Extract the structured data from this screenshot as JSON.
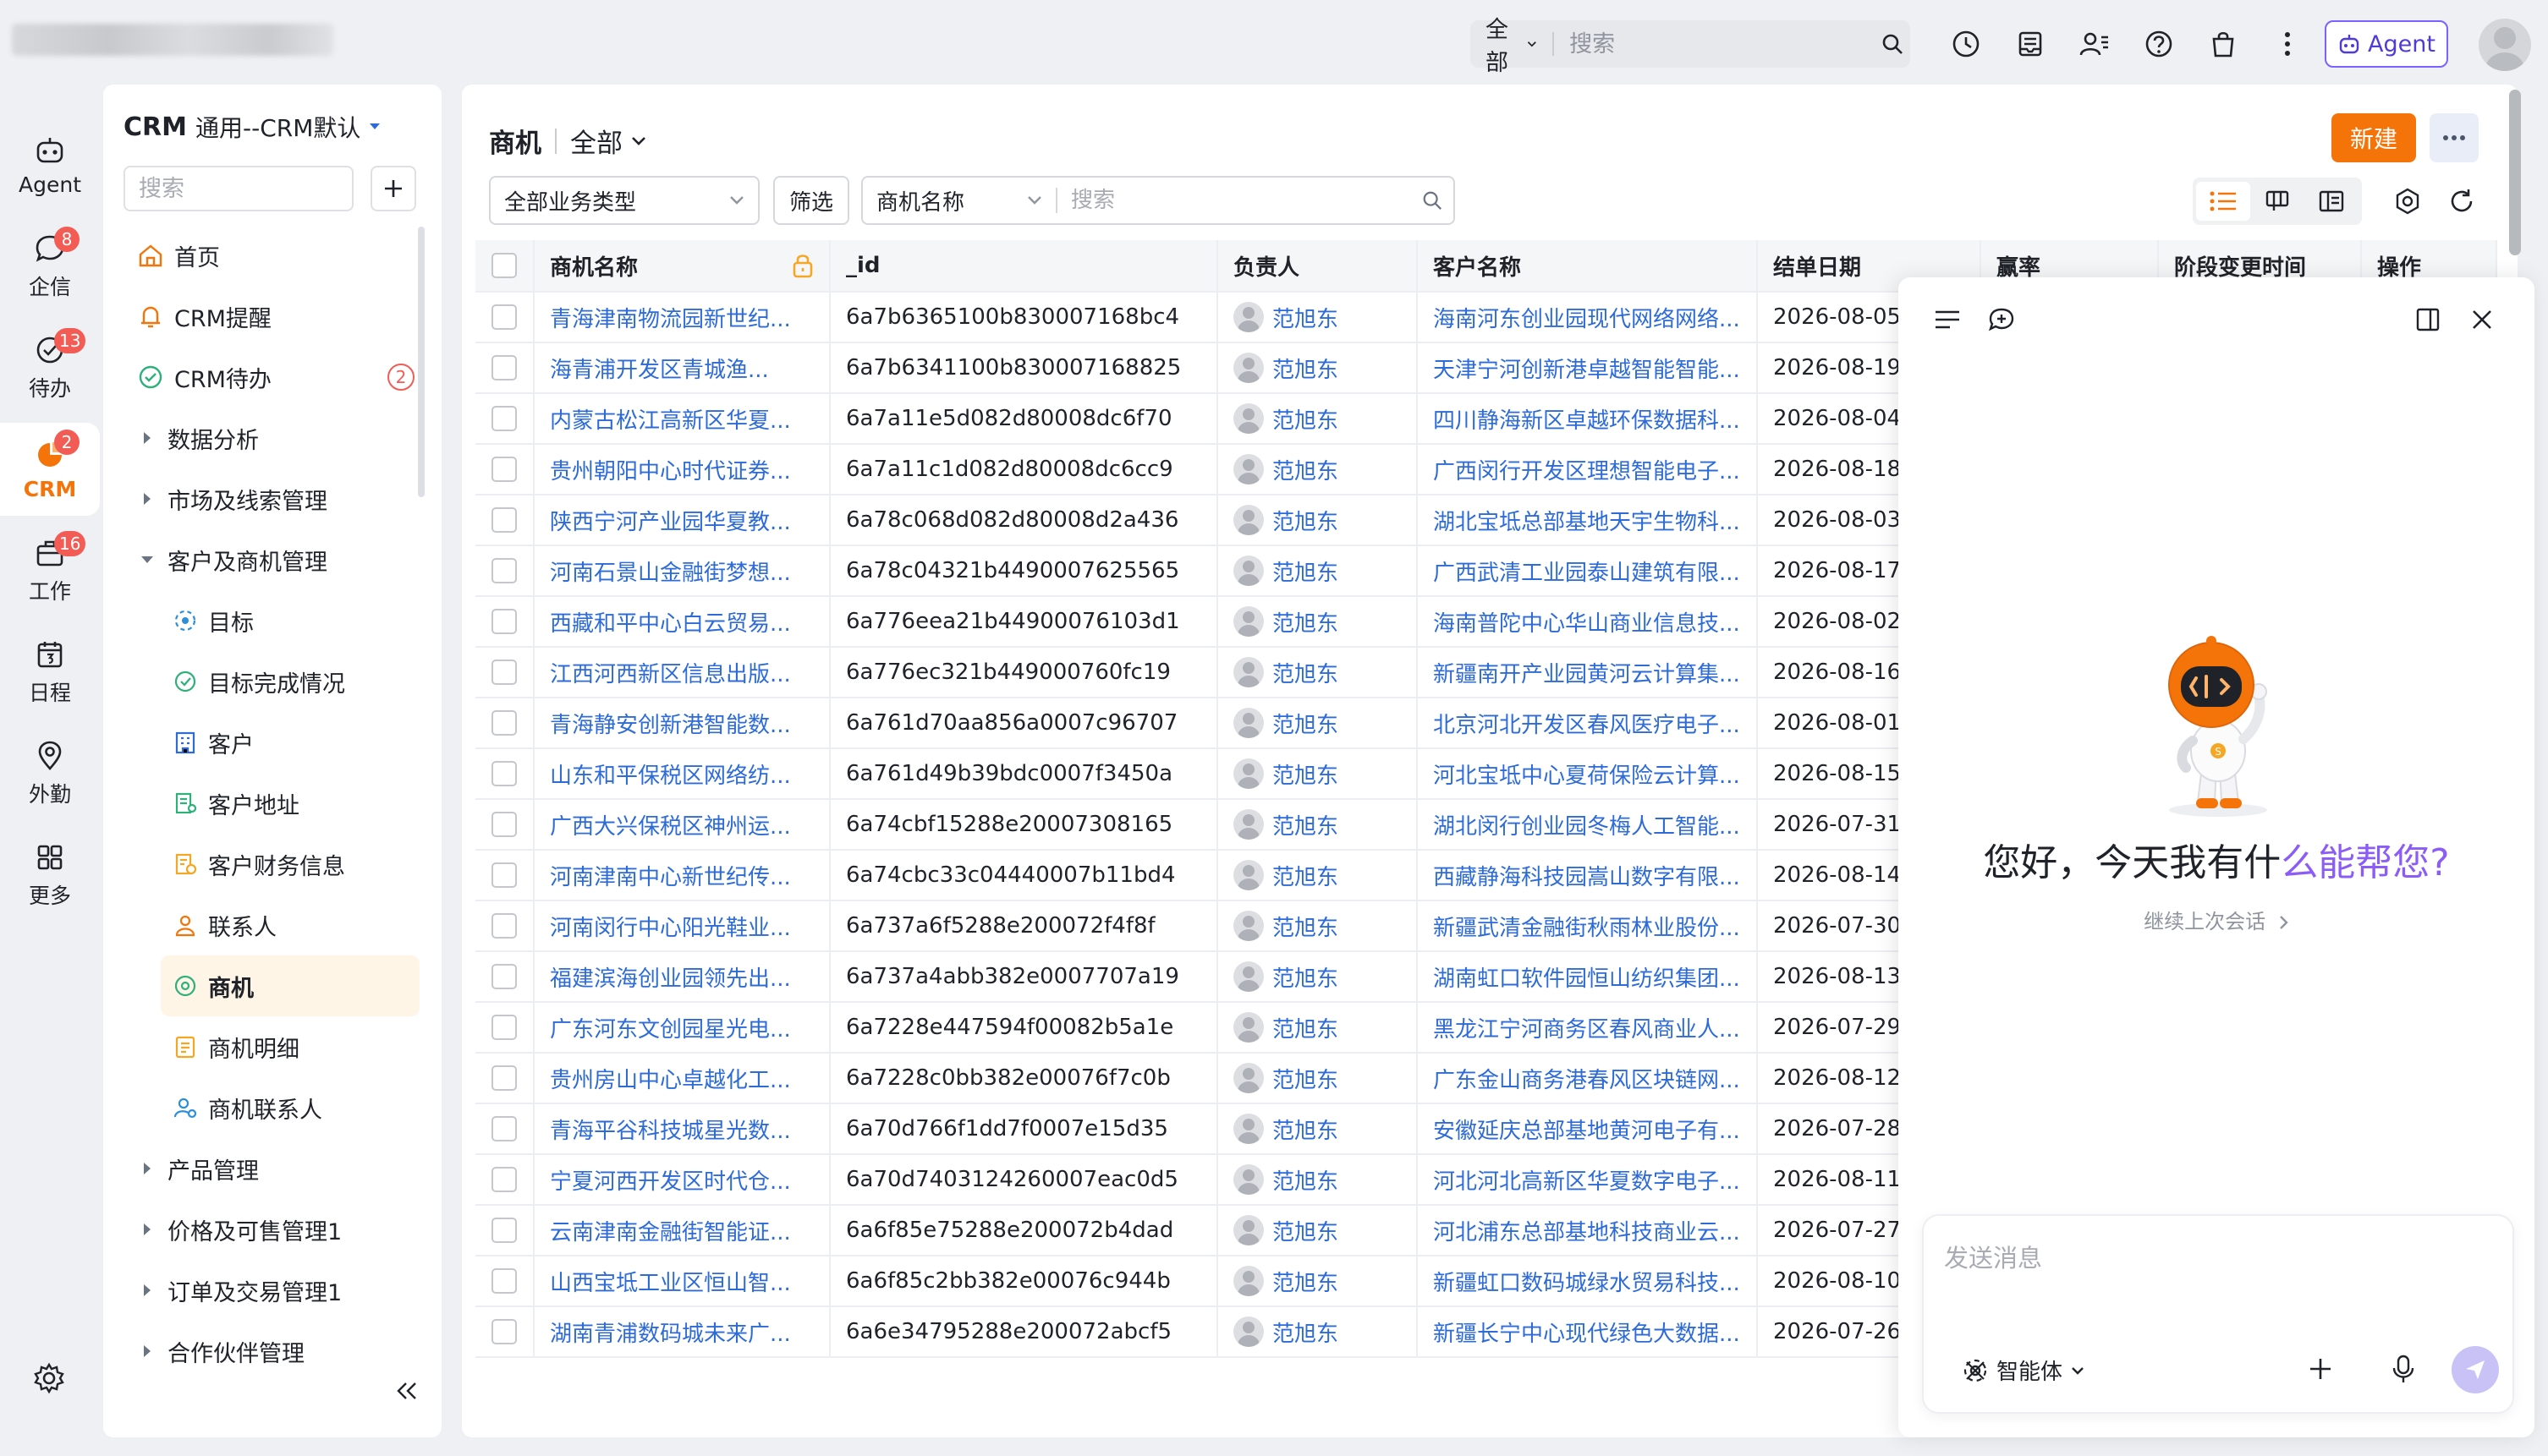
{
  "topbar": {
    "search_scope": "全部",
    "search_placeholder": "搜索",
    "agent_label": "Agent",
    "icons": [
      "history-icon",
      "inbox-icon",
      "contacts-icon",
      "help-icon",
      "shopping-bag-icon",
      "more-vertical-icon"
    ]
  },
  "rail": {
    "items": [
      {
        "label": "Agent",
        "icon": "agent-bot-icon",
        "badge": ""
      },
      {
        "label": "企信",
        "icon": "chat-bubble-icon",
        "badge": "8"
      },
      {
        "label": "待办",
        "icon": "todo-check-icon",
        "badge": "13"
      },
      {
        "label": "CRM",
        "icon": "crm-icon",
        "badge": "2"
      },
      {
        "label": "工作",
        "icon": "briefcase-icon",
        "badge": "16"
      },
      {
        "label": "日程",
        "icon": "calendar-icon",
        "badge": ""
      },
      {
        "label": "外勤",
        "icon": "location-pin-icon",
        "badge": ""
      },
      {
        "label": "更多",
        "icon": "grid-icon",
        "badge": ""
      }
    ]
  },
  "nav": {
    "app_name": "CRM",
    "workspace": "通用--CRM默认",
    "search_placeholder": "搜索",
    "items": [
      {
        "label": "首页",
        "level": 1,
        "icon": "home-icon"
      },
      {
        "label": "CRM提醒",
        "level": 1,
        "icon": "bell-icon"
      },
      {
        "label": "CRM待办",
        "level": 1,
        "icon": "check-circle-icon",
        "badge": "2"
      },
      {
        "label": "数据分析",
        "level": 1,
        "caret": "right"
      },
      {
        "label": "市场及线索管理",
        "level": 1,
        "caret": "right"
      },
      {
        "label": "客户及商机管理",
        "level": 1,
        "caret": "down"
      },
      {
        "label": "目标",
        "level": 2,
        "icon": "target-icon"
      },
      {
        "label": "目标完成情况",
        "level": 2,
        "icon": "target-check-icon"
      },
      {
        "label": "客户",
        "level": 2,
        "icon": "building-icon"
      },
      {
        "label": "客户地址",
        "level": 2,
        "icon": "address-icon"
      },
      {
        "label": "客户财务信息",
        "level": 2,
        "icon": "finance-icon"
      },
      {
        "label": "联系人",
        "level": 2,
        "icon": "person-icon"
      },
      {
        "label": "商机",
        "level": 2,
        "icon": "opportunity-icon",
        "active": true
      },
      {
        "label": "商机明细",
        "level": 2,
        "icon": "detail-icon"
      },
      {
        "label": "商机联系人",
        "level": 2,
        "icon": "contact-link-icon"
      },
      {
        "label": "产品管理",
        "level": 1,
        "caret": "right"
      },
      {
        "label": "价格及可售管理1",
        "level": 1,
        "caret": "right"
      },
      {
        "label": "订单及交易管理1",
        "level": 1,
        "caret": "right"
      },
      {
        "label": "合作伙伴管理",
        "level": 1,
        "caret": "right"
      }
    ]
  },
  "main": {
    "title": "商机",
    "scope": "全部",
    "new_label": "新建",
    "filter_type": "全部业务类型",
    "filter_button": "筛选",
    "search_field": "商机名称",
    "search_placeholder": "搜索",
    "columns": [
      "商机名称",
      "_id",
      "负责人",
      "客户名称",
      "结单日期",
      "赢率",
      "阶段变更时间",
      "操作"
    ],
    "rows": [
      {
        "name": "青海津南物流园新世纪...",
        "id": "6a7b6365100b830007168bc4",
        "owner": "范旭东",
        "customer": "海南河东创业园现代网络网络...",
        "date": "2026-08-05"
      },
      {
        "name": "海青浦开发区青城渔...",
        "id": "6a7b6341100b830007168825",
        "owner": "范旭东",
        "customer": "天津宁河创新港卓越智能智能...",
        "date": "2026-08-19"
      },
      {
        "name": "内蒙古松江高新区华夏...",
        "id": "6a7a11e5d082d80008dc6f70",
        "owner": "范旭东",
        "customer": "四川静海新区卓越环保数据科...",
        "date": "2026-08-04"
      },
      {
        "name": "贵州朝阳中心时代证券...",
        "id": "6a7a11c1d082d80008dc6cc9",
        "owner": "范旭东",
        "customer": "广西闵行开发区理想智能电子...",
        "date": "2026-08-18"
      },
      {
        "name": "陕西宁河产业园华夏教...",
        "id": "6a78c068d082d80008d2a436",
        "owner": "范旭东",
        "customer": "湖北宝坻总部基地天宇生物科...",
        "date": "2026-08-03"
      },
      {
        "name": "河南石景山金融街梦想...",
        "id": "6a78c04321b4490007625565",
        "owner": "范旭东",
        "customer": "广西武清工业园泰山建筑有限...",
        "date": "2026-08-17"
      },
      {
        "name": "西藏和平中心白云贸易...",
        "id": "6a776eea21b44900076103d1",
        "owner": "范旭东",
        "customer": "海南普陀中心华山商业信息技...",
        "date": "2026-08-02"
      },
      {
        "name": "江西河西新区信息出版...",
        "id": "6a776ec321b449000760fc19",
        "owner": "范旭东",
        "customer": "新疆南开产业园黄河云计算集...",
        "date": "2026-08-16"
      },
      {
        "name": "青海静安创新港智能数...",
        "id": "6a761d70aa856a0007c96707",
        "owner": "范旭东",
        "customer": "北京河北开发区春风医疗电子...",
        "date": "2026-08-01"
      },
      {
        "name": "山东和平保税区网络纺...",
        "id": "6a761d49b39bdc0007f3450a",
        "owner": "范旭东",
        "customer": "河北宝坻中心夏荷保险云计算...",
        "date": "2026-08-15"
      },
      {
        "name": "广西大兴保税区神州运...",
        "id": "6a74cbf15288e20007308165",
        "owner": "范旭东",
        "customer": "湖北闵行创业园冬梅人工智能...",
        "date": "2026-07-31"
      },
      {
        "name": "河南津南中心新世纪传...",
        "id": "6a74cbc33c04440007b11bd4",
        "owner": "范旭东",
        "customer": "西藏静海科技园嵩山数字有限...",
        "date": "2026-08-14"
      },
      {
        "name": "河南闵行中心阳光鞋业...",
        "id": "6a737a6f5288e200072f4f8f",
        "owner": "范旭东",
        "customer": "新疆武清金融街秋雨林业股份...",
        "date": "2026-07-30"
      },
      {
        "name": "福建滨海创业园领先出...",
        "id": "6a737a4abb382e0007707a19",
        "owner": "范旭东",
        "customer": "湖南虹口软件园恒山纺织集团...",
        "date": "2026-08-13"
      },
      {
        "name": "广东河东文创园星光电...",
        "id": "6a7228e447594f00082b5a1e",
        "owner": "范旭东",
        "customer": "黑龙江宁河商务区春风商业人...",
        "date": "2026-07-29"
      },
      {
        "name": "贵州房山中心卓越化工...",
        "id": "6a7228c0bb382e00076f7c0b",
        "owner": "范旭东",
        "customer": "广东金山商务港春风区块链网...",
        "date": "2026-08-12"
      },
      {
        "name": "青海平谷科技城星光数...",
        "id": "6a70d766f1dd7f0007e15d35",
        "owner": "范旭东",
        "customer": "安徽延庆总部基地黄河电子有...",
        "date": "2026-07-28"
      },
      {
        "name": "宁夏河西开发区时代仓...",
        "id": "6a70d7403124260007eac0d5",
        "owner": "范旭东",
        "customer": "河北河北高新区华夏数字电子...",
        "date": "2026-08-11"
      },
      {
        "name": "云南津南金融街智能证...",
        "id": "6a6f85e75288e200072b4dad",
        "owner": "范旭东",
        "customer": "河北浦东总部基地科技商业云...",
        "date": "2026-07-27"
      },
      {
        "name": "山西宝坻工业区恒山智...",
        "id": "6a6f85c2bb382e00076c944b",
        "owner": "范旭东",
        "customer": "新疆虹口数码城绿水贸易科技...",
        "date": "2026-08-10"
      },
      {
        "name": "湖南青浦数码城未来广...",
        "id": "6a6e34795288e200072abcf5",
        "owner": "范旭东",
        "customer": "新疆长宁中心现代绿色大数据...",
        "date": "2026-07-26"
      }
    ]
  },
  "agent_panel": {
    "greeting_main": "您好，今天我有什",
    "greeting_accent": "么能帮您?",
    "continue_label": "继续上次会话",
    "message_placeholder": "发送消息",
    "mode_label": "智能体"
  },
  "colors": {
    "accent_orange": "#f5740a",
    "link_blue": "#2d6bd8",
    "badge_red": "#f25c54",
    "agent_purple": "#7b61ff"
  }
}
